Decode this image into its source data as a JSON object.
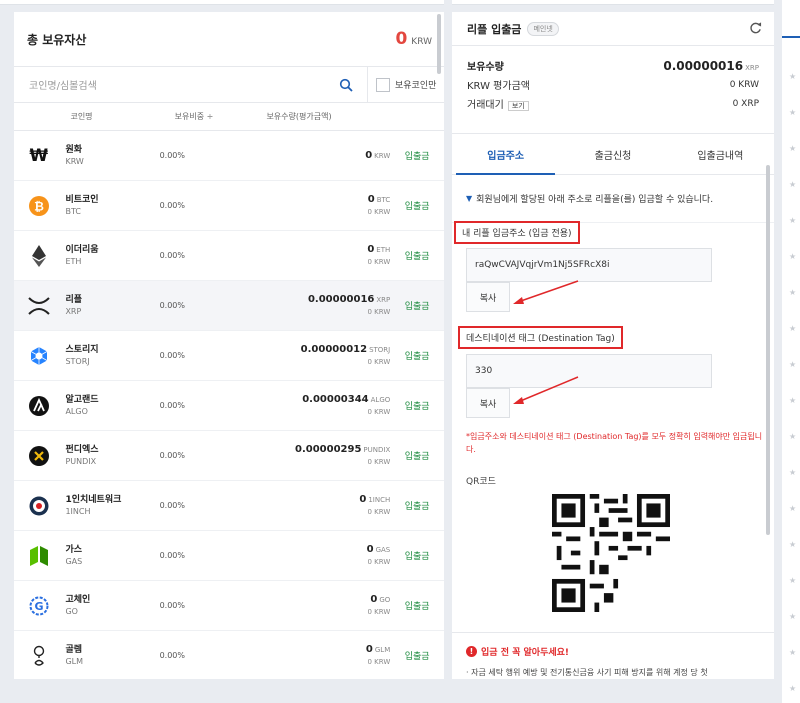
{
  "total": {
    "label": "총 보유자산",
    "value": "0",
    "unit": "KRW"
  },
  "search": {
    "placeholder": "코인명/심볼검색",
    "owned_only_label": "보유코인만"
  },
  "columns": {
    "name": "코인명",
    "ratio": "보유비중 ÷",
    "qty": "보유수량(평가금액)"
  },
  "coins": [
    {
      "name": "원화",
      "symbol": "KRW",
      "ratio": "0.00%",
      "qty": "0",
      "qty_unit": "KRW",
      "krw": "",
      "action": "입출금",
      "icon": "won-icon"
    },
    {
      "name": "비트코인",
      "symbol": "BTC",
      "ratio": "0.00%",
      "qty": "0",
      "qty_unit": "BTC",
      "krw": "0 KRW",
      "action": "입출금",
      "icon": "bitcoin-icon"
    },
    {
      "name": "이더리움",
      "symbol": "ETH",
      "ratio": "0.00%",
      "qty": "0",
      "qty_unit": "ETH",
      "krw": "0 KRW",
      "action": "입출금",
      "icon": "ethereum-icon"
    },
    {
      "name": "리플",
      "symbol": "XRP",
      "ratio": "0.00%",
      "qty": "0.00000016",
      "qty_unit": "XRP",
      "krw": "0 KRW",
      "action": "입출금",
      "icon": "ripple-icon"
    },
    {
      "name": "스토리지",
      "symbol": "STORJ",
      "ratio": "0.00%",
      "qty": "0.00000012",
      "qty_unit": "STORJ",
      "krw": "0 KRW",
      "action": "입출금",
      "icon": "storj-icon"
    },
    {
      "name": "알고랜드",
      "symbol": "ALGO",
      "ratio": "0.00%",
      "qty": "0.00000344",
      "qty_unit": "ALGO",
      "krw": "0 KRW",
      "action": "입출금",
      "icon": "algorand-icon"
    },
    {
      "name": "펀디엑스",
      "symbol": "PUNDIX",
      "ratio": "0.00%",
      "qty": "0.00000295",
      "qty_unit": "PUNDIX",
      "krw": "0 KRW",
      "action": "입출금",
      "icon": "pundix-icon"
    },
    {
      "name": "1인치네트워크",
      "symbol": "1INCH",
      "ratio": "0.00%",
      "qty": "0",
      "qty_unit": "1INCH",
      "krw": "0 KRW",
      "action": "입출금",
      "icon": "1inch-icon"
    },
    {
      "name": "가스",
      "symbol": "GAS",
      "ratio": "0.00%",
      "qty": "0",
      "qty_unit": "GAS",
      "krw": "0 KRW",
      "action": "입출금",
      "icon": "gas-icon"
    },
    {
      "name": "고체인",
      "symbol": "GO",
      "ratio": "0.00%",
      "qty": "0",
      "qty_unit": "GO",
      "krw": "0 KRW",
      "action": "입출금",
      "icon": "gochain-icon"
    },
    {
      "name": "골렘",
      "symbol": "GLM",
      "ratio": "0.00%",
      "qty": "0",
      "qty_unit": "GLM",
      "krw": "0 KRW",
      "action": "입출금",
      "icon": "golem-icon"
    }
  ],
  "right": {
    "title": "리플 입출금",
    "badge": "메인넷",
    "summary": {
      "holding_label": "보유수량",
      "holding_value": "0.00000016",
      "holding_unit": "XRP",
      "krw_label": "KRW 평가금액",
      "krw_value": "0 KRW",
      "pending_label": "거래대기",
      "pending_btn": "보기",
      "pending_value": "0 XRP"
    },
    "tabs": [
      "입금주소",
      "출금신청",
      "입출금내역"
    ],
    "notice": "회원님에게 할당된 아래 주소로 리플을(를) 입금할 수 있습니다.",
    "address_label": "내 리플 입금주소 (입금 전용)",
    "address_value": "raQwCVAJVqjrVm1Nj5SFRcX8i",
    "copy_label": "복사",
    "tag_label": "데스티네이션 태그 (Destination Tag)",
    "tag_value": "330",
    "warning": "*입금주소와 데스티네이션 태그 (Destination Tag)를 모두 정확히 입력해야만 입금됩니다.",
    "qr_label": "QR코드",
    "info_title": "입금 전 꼭 알아두세요!",
    "info_text": "· 자금 세탁 행위 예방 및 전기통신금융 사기 피해 방지를 위해 계정 당 첫"
  },
  "colors": {
    "accent": "#1e5fb5",
    "red": "#e3473f",
    "green": "#1b8a3d"
  }
}
